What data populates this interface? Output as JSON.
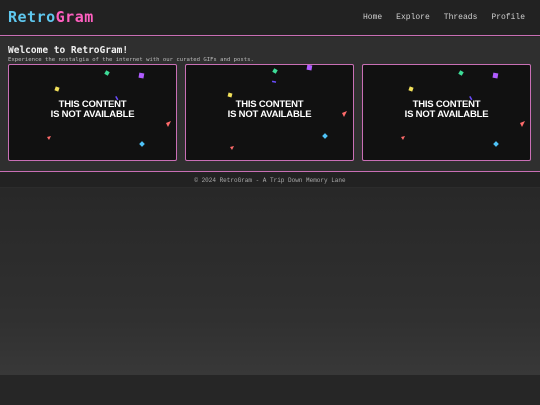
{
  "header": {
    "logo_part1": "Retro",
    "logo_part2": "Gram",
    "nav": [
      "Home",
      "Explore",
      "Threads",
      "Profile"
    ]
  },
  "main": {
    "welcome_title": "Welcome to RetroGram!",
    "welcome_sub": "Experience the nostalgia of the internet with our curated GIFs and posts."
  },
  "cards": [
    {
      "line1": "THIS CONTENT",
      "line2": "IS NOT AVAILABLE"
    },
    {
      "line1": "THIS CONTENT",
      "line2": "IS NOT AVAILABLE"
    },
    {
      "line1": "THIS CONTENT",
      "line2": "IS NOT AVAILABLE"
    }
  ],
  "footer": {
    "text": "© 2024 RetroGram - A Trip Down Memory Lane"
  },
  "colors": {
    "accent_pink": "#ff5fc0",
    "accent_blue": "#5fc8ef",
    "border": "#c96fb5"
  }
}
